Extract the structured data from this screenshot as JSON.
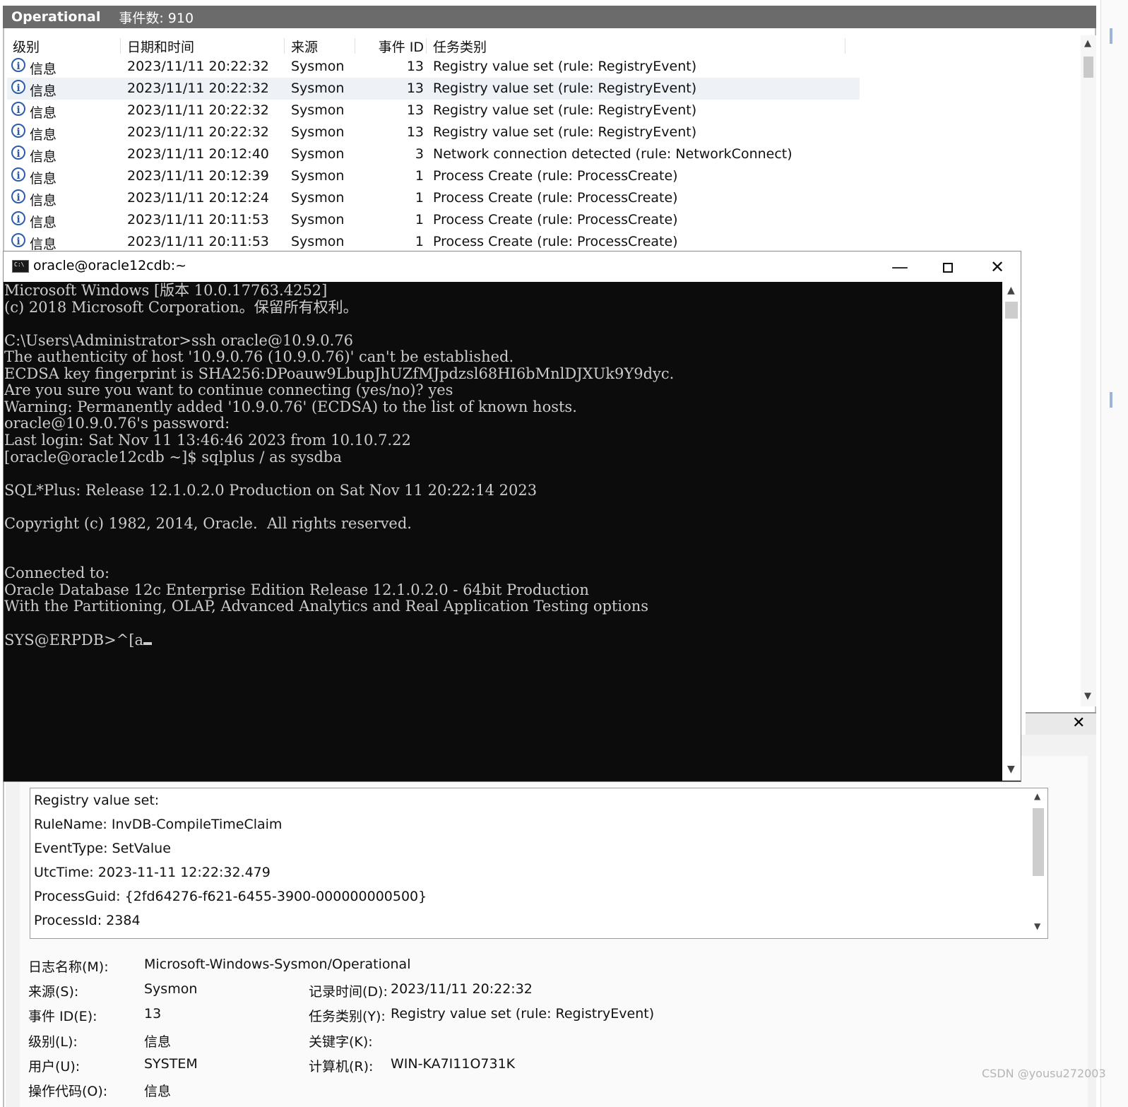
{
  "event_viewer": {
    "log_name": "Operational",
    "event_count": "事件数: 910",
    "columns": {
      "level": "级别",
      "date": "日期和时间",
      "source": "来源",
      "event_id": "事件 ID",
      "task": "任务类别"
    },
    "rows": [
      {
        "level": "信息",
        "date": "2023/11/11 20:22:32",
        "source": "Sysmon",
        "event_id": "13",
        "task": "Registry value set (rule: RegistryEvent)"
      },
      {
        "level": "信息",
        "date": "2023/11/11 20:22:32",
        "source": "Sysmon",
        "event_id": "13",
        "task": "Registry value set (rule: RegistryEvent)"
      },
      {
        "level": "信息",
        "date": "2023/11/11 20:22:32",
        "source": "Sysmon",
        "event_id": "13",
        "task": "Registry value set (rule: RegistryEvent)"
      },
      {
        "level": "信息",
        "date": "2023/11/11 20:22:32",
        "source": "Sysmon",
        "event_id": "13",
        "task": "Registry value set (rule: RegistryEvent)"
      },
      {
        "level": "信息",
        "date": "2023/11/11 20:12:40",
        "source": "Sysmon",
        "event_id": "3",
        "task": "Network connection detected (rule: NetworkConnect)"
      },
      {
        "level": "信息",
        "date": "2023/11/11 20:12:39",
        "source": "Sysmon",
        "event_id": "1",
        "task": "Process Create (rule: ProcessCreate)"
      },
      {
        "level": "信息",
        "date": "2023/11/11 20:12:24",
        "source": "Sysmon",
        "event_id": "1",
        "task": "Process Create (rule: ProcessCreate)"
      },
      {
        "level": "信息",
        "date": "2023/11/11 20:11:53",
        "source": "Sysmon",
        "event_id": "1",
        "task": "Process Create (rule: ProcessCreate)"
      },
      {
        "level": "信息",
        "date": "2023/11/11 20:11:53",
        "source": "Sysmon",
        "event_id": "1",
        "task": "Process Create (rule: ProcessCreate)"
      }
    ],
    "selected_row": 1,
    "description": [
      "Registry value set:",
      "RuleName: InvDB-CompileTimeClaim",
      "EventType: SetValue",
      "UtcTime: 2023-11-11 12:22:32.479",
      "ProcessGuid: {2fd64276-f621-6455-3900-000000000500}",
      "ProcessId: 2384"
    ],
    "properties": {
      "log_name_label": "日志名称(M):",
      "log_name_value": "Microsoft-Windows-Sysmon/Operational",
      "source_label": "来源(S):",
      "source_value": "Sysmon",
      "logged_label": "记录时间(D):",
      "logged_value": "2023/11/11 20:22:32",
      "event_id_label": "事件 ID(E):",
      "event_id_value": "13",
      "task_label": "任务类别(Y):",
      "task_value": "Registry value set (rule: RegistryEvent)",
      "level_label": "级别(L):",
      "level_value": "信息",
      "keywords_label": "关键字(K):",
      "keywords_value": "",
      "user_label": "用户(U):",
      "user_value": "SYSTEM",
      "computer_label": "计算机(R):",
      "computer_value": "WIN-KA7I11O731K",
      "opcode_label": "操作代码(O):",
      "opcode_value": "信息"
    }
  },
  "console": {
    "title": "oracle@oracle12cdb:~",
    "minimize": "—",
    "close": "✕",
    "lines": [
      "Microsoft Windows [版本 10.0.17763.4252]",
      "(c) 2018 Microsoft Corporation。保留所有权利。",
      "",
      "C:\\Users\\Administrator>ssh oracle@10.9.0.76",
      "The authenticity of host '10.9.0.76 (10.9.0.76)' can't be established.",
      "ECDSA key fingerprint is SHA256:DPoauw9LbupJhUZfMJpdzsl68HI6bMnlDJXUk9Y9dyc.",
      "Are you sure you want to continue connecting (yes/no)? yes",
      "Warning: Permanently added '10.9.0.76' (ECDSA) to the list of known hosts.",
      "oracle@10.9.0.76's password:",
      "Last login: Sat Nov 11 13:46:46 2023 from 10.10.7.22",
      "[oracle@oracle12cdb ~]$ sqlplus / as sysdba",
      "",
      "SQL*Plus: Release 12.1.0.2.0 Production on Sat Nov 11 20:22:14 2023",
      "",
      "Copyright (c) 1982, 2014, Oracle.  All rights reserved.",
      "",
      "",
      "Connected to:",
      "Oracle Database 12c Enterprise Edition Release 12.1.0.2.0 - 64bit Production",
      "With the Partitioning, OLAP, Advanced Analytics and Real Application Testing options",
      "",
      "SYS@ERPDB>^[a"
    ]
  },
  "watermark": "CSDN @yousu272003"
}
